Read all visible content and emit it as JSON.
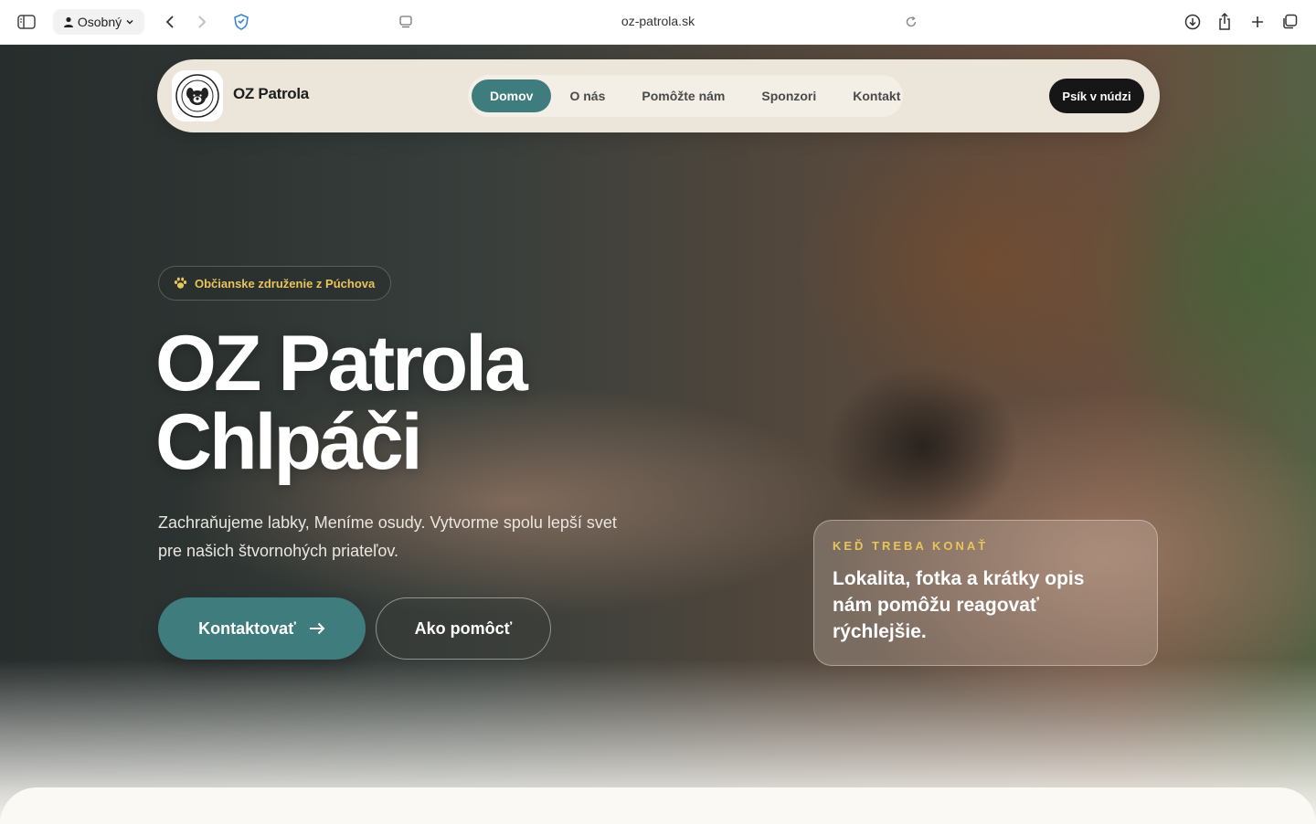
{
  "browser": {
    "profile_label": "Osobný",
    "url": "oz-patrola.sk"
  },
  "nav": {
    "brand": "OZ Patrola",
    "links": [
      "Domov",
      "O nás",
      "Pomôžte nám",
      "Sponzori",
      "Kontakt"
    ],
    "active_index": 0,
    "cta": "Psík v núdzi"
  },
  "hero": {
    "badge": "Občianske združenie z Púchova",
    "title_line1": "OZ Patrola",
    "title_line2": "Chlpáči",
    "subtitle": "Zachraňujeme labky, Meníme osudy. Vytvorme spolu lepší svet pre našich štvornohých priateľov.",
    "primary_button": "Kontaktovať",
    "secondary_button": "Ako pomôcť"
  },
  "callout": {
    "eyebrow": "KEĎ TREBA KONAŤ",
    "text": "Lokalita, fotka a krátky opis nám pomôžu reagovať rýchlejšie."
  },
  "colors": {
    "accent": "#3e7c7d",
    "gold": "#e8c45a",
    "nav_bg": "#ece6da"
  }
}
